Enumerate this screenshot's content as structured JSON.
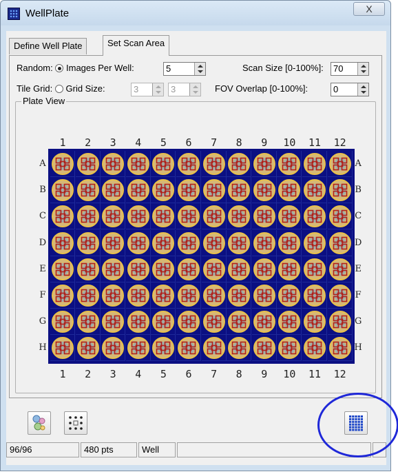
{
  "window": {
    "title": "WellPlate",
    "close_glyph": "X"
  },
  "tabs": [
    {
      "label": "Define Well Plate",
      "active": false
    },
    {
      "label": "Set Scan Area",
      "active": true
    }
  ],
  "scan_options": {
    "random_label": "Random:",
    "images_per_well_label": "Images Per Well:",
    "images_per_well_value": "5",
    "scan_size_label": "Scan Size [0-100%]:",
    "scan_size_value": "70",
    "tile_grid_label": "Tile Grid:",
    "grid_size_label": "Grid Size:",
    "grid_size_x": "3",
    "grid_size_y": "3",
    "fov_overlap_label": "FOV Overlap [0-100%]:",
    "fov_overlap_value": "0",
    "selected_mode": "random"
  },
  "plate_view": {
    "title": "Plate View",
    "columns": [
      "1",
      "2",
      "3",
      "4",
      "5",
      "6",
      "7",
      "8",
      "9",
      "10",
      "11",
      "12"
    ],
    "rows": [
      "A",
      "B",
      "C",
      "D",
      "E",
      "F",
      "G",
      "H"
    ],
    "colors": {
      "plate_bg": "#0b0f82",
      "well_ring": "#e8c04a",
      "well_fill": "#d6b877",
      "tile": "#b0201a"
    }
  },
  "toolbar": {
    "random_icon": "random-scatter-icon",
    "grid_icon": "grid-pattern-icon",
    "full_plate_icon": "full-plate-icon"
  },
  "status_bar": {
    "wells": "96/96",
    "points": "480 pts",
    "mode": "Well",
    "message": "",
    "extra": ""
  },
  "annotation_color": "#1f28d8"
}
